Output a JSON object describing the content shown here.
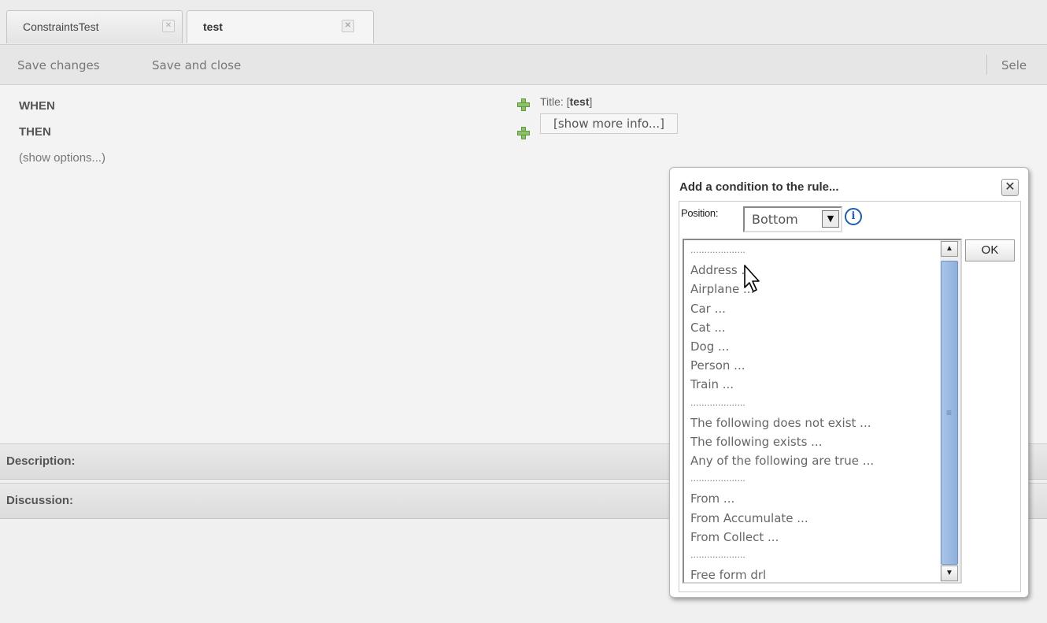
{
  "tabs": [
    {
      "label": "ConstraintsTest",
      "active": false
    },
    {
      "label": "test",
      "active": true
    }
  ],
  "toolbar": {
    "save_changes": "Save changes",
    "save_and_close": "Save and close",
    "select_truncated": "Sele"
  },
  "rule": {
    "when": "WHEN",
    "then": "THEN",
    "show_options": "(show options...)",
    "title_label": "Title: [",
    "title_value": "test",
    "title_end": "]",
    "show_more_info": "[show more info...]"
  },
  "sections": {
    "description": "Description:",
    "discussion": "Discussion:"
  },
  "dialog": {
    "title": "Add a condition to the rule...",
    "close_symbol": "✕",
    "position_label": "Position:",
    "position_value": "Bottom",
    "info_symbol": "i",
    "ok_label": "OK",
    "items": [
      "....................",
      "Address ...",
      "Airplane ...",
      "Car ...",
      "Cat ...",
      "Dog ...",
      "Person ...",
      "Train ...",
      "....................",
      "The following does not exist ...",
      "The following exists ...",
      "Any of the following are true ...",
      "....................",
      "From ...",
      "From Accumulate ...",
      "From Collect ...",
      "....................",
      "Free form drl"
    ]
  },
  "icons": {
    "tab_close": "close-icon",
    "add": "plus-icon",
    "info": "info-icon",
    "dropdown": "chevron-down-icon"
  },
  "colors": {
    "add_icon": "#8cc06b",
    "info_icon": "#1b5db0",
    "scroll_thumb": "#9bb8e2"
  }
}
